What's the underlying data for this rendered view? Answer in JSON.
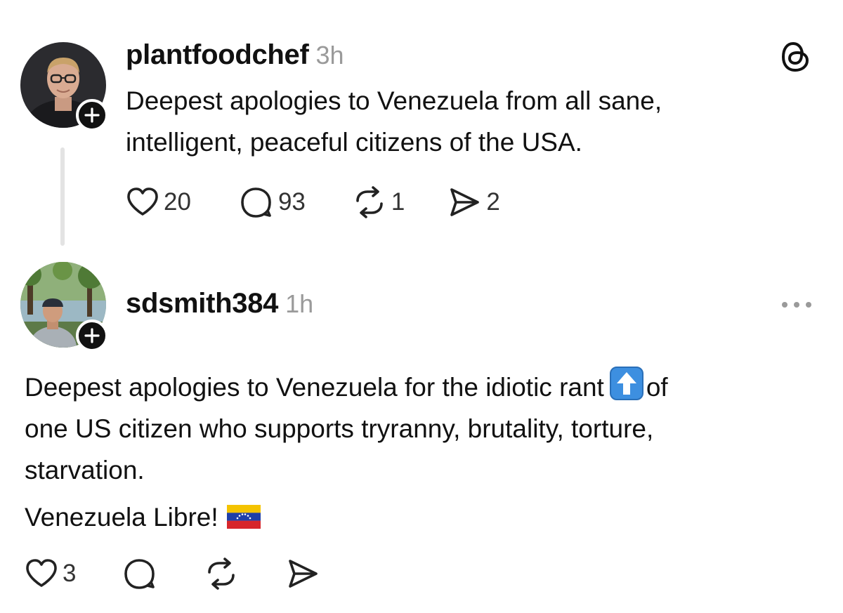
{
  "post1": {
    "username": "plantfoodchef",
    "timestamp": "3h",
    "lines": [
      "Deepest apologies to Venezuela from all sane,",
      "intelligent, peaceful citizens of the USA."
    ],
    "likes": "20",
    "replies": "93",
    "reposts": "1",
    "shares": "2"
  },
  "post2": {
    "username": "sdsmith384",
    "timestamp": "1h",
    "line1_before": "Deepest apologies to Venezuela for the idiotic rant",
    "line1_after": "of",
    "line2": "one US citizen who supports tryranny, brutality, torture,",
    "line3": "starvation.",
    "line4": "Venezuela Libre!",
    "likes": "3"
  },
  "icons": {
    "app_logo": "threads-logo-icon",
    "more": "more-options-icon",
    "like": "heart-icon",
    "reply": "comment-bubble-icon",
    "repost": "repost-icon",
    "share": "send-icon",
    "follow": "plus-icon",
    "up_arrow_emoji": "up-arrow-emoji",
    "flag_emoji": "venezuela-flag-emoji"
  },
  "colors": {
    "text": "#111111",
    "secondary": "#9a9a9a",
    "thread_line": "#e3e3e3",
    "emoji_blue": "#3d8fe0"
  }
}
